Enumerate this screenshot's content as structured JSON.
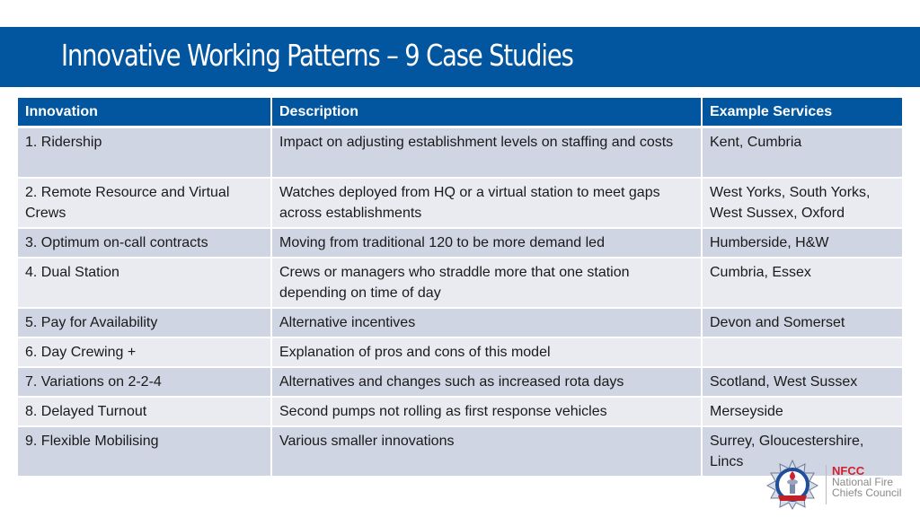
{
  "slide": {
    "title": "Innovative Working Patterns – 9 Case Studies"
  },
  "table": {
    "headers": [
      "Innovation",
      "Description",
      "Example Services"
    ],
    "rows": [
      {
        "innovation": "1.   Ridership",
        "description": "Impact on adjusting establishment levels on  staffing and costs",
        "services": "Kent, Cumbria"
      },
      {
        "innovation": "2. Remote Resource and Virtual Crews",
        "description": "Watches deployed from HQ or a virtual station to meet gaps across establishments",
        "services": "West Yorks, South Yorks, West Sussex, Oxford"
      },
      {
        "innovation": "3. Optimum on-call contracts",
        "description": "Moving from traditional 120 to be more demand led",
        "services": "Humberside, H&W"
      },
      {
        "innovation": "4. Dual Station",
        "description": "Crews or managers who straddle more that one station depending on time of day",
        "services": "Cumbria, Essex"
      },
      {
        "innovation": "5. Pay for Availability",
        "description": "Alternative incentives",
        "services": "Devon and Somerset"
      },
      {
        "innovation": "6. Day Crewing +",
        "description": "Explanation of pros and cons of this model",
        "services": ""
      },
      {
        "innovation": "7. Variations on 2-2-4",
        "description": "Alternatives and changes such as increased rota days",
        "services": "Scotland, West Sussex"
      },
      {
        "innovation": "8. Delayed Turnout",
        "description": "Second pumps not rolling as first response vehicles",
        "services": "Merseyside"
      },
      {
        "innovation": "9. Flexible Mobilising",
        "description": "Various smaller innovations",
        "services": "Surrey, Gloucestershire, Lincs"
      }
    ]
  },
  "logo": {
    "acronym": "NFCC",
    "name": "National Fire Chiefs Council",
    "icon": "fire-service-star-emblem-icon"
  },
  "colors": {
    "brand_blue": "#02559f",
    "row_dark": "#cfd5e2",
    "row_light": "#e9ebf1",
    "logo_red": "#d3202e"
  }
}
